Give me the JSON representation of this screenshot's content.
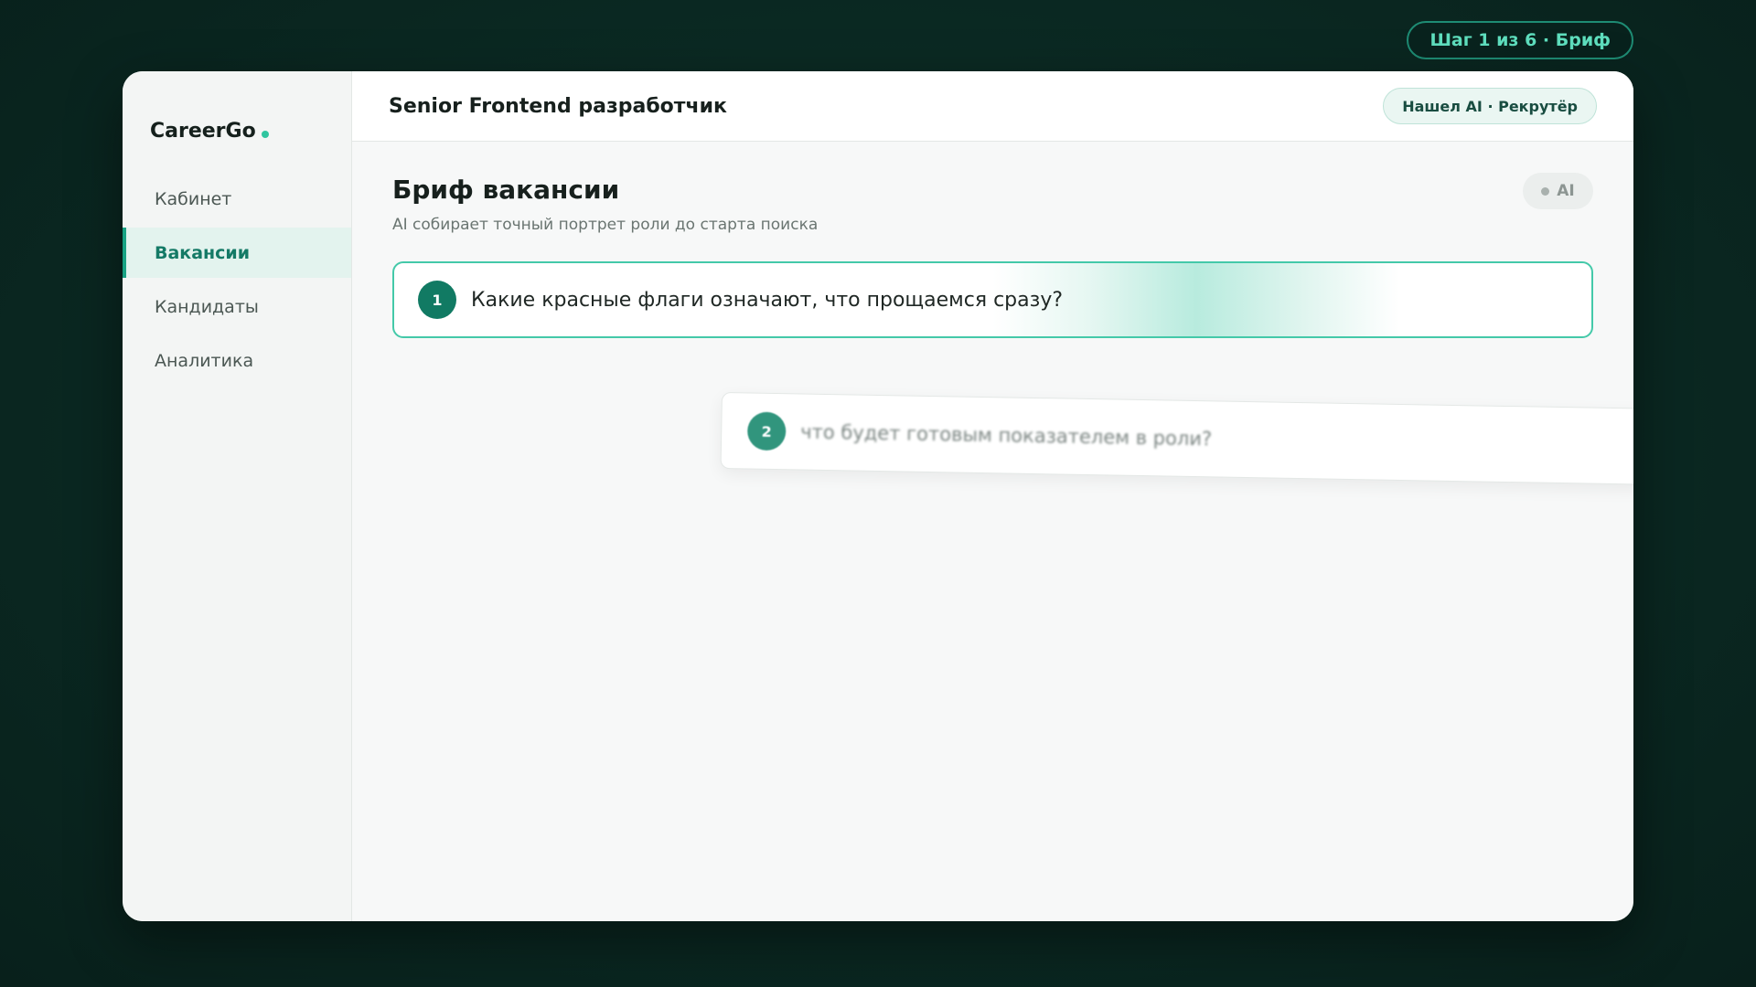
{
  "step_indicator": "Шаг 1 из 6 · Бриф",
  "sidebar": {
    "brand": "CareerGo",
    "items": [
      {
        "label": "Кабинет",
        "active": false
      },
      {
        "label": "Вакансии",
        "active": true
      },
      {
        "label": "Кандидаты",
        "active": false
      },
      {
        "label": "Аналитика",
        "active": false
      }
    ]
  },
  "header": {
    "job_title": "Senior Frontend разработчик",
    "badge": "Нашел AI · Рекрутёр"
  },
  "brief": {
    "title": "Бриф вакансии",
    "subtitle": "AI собирает точный портрет роли до старта поиска",
    "ai_label": "AI",
    "questions": [
      {
        "number": "1",
        "text": "Какие красные флаги означают, что прощаемся сразу?"
      },
      {
        "number": "2",
        "text": "что будет готовым показателем в роли?"
      }
    ]
  },
  "colors": {
    "accent": "#19a283",
    "accent_dark": "#117a63",
    "background": "#0b2b24"
  }
}
